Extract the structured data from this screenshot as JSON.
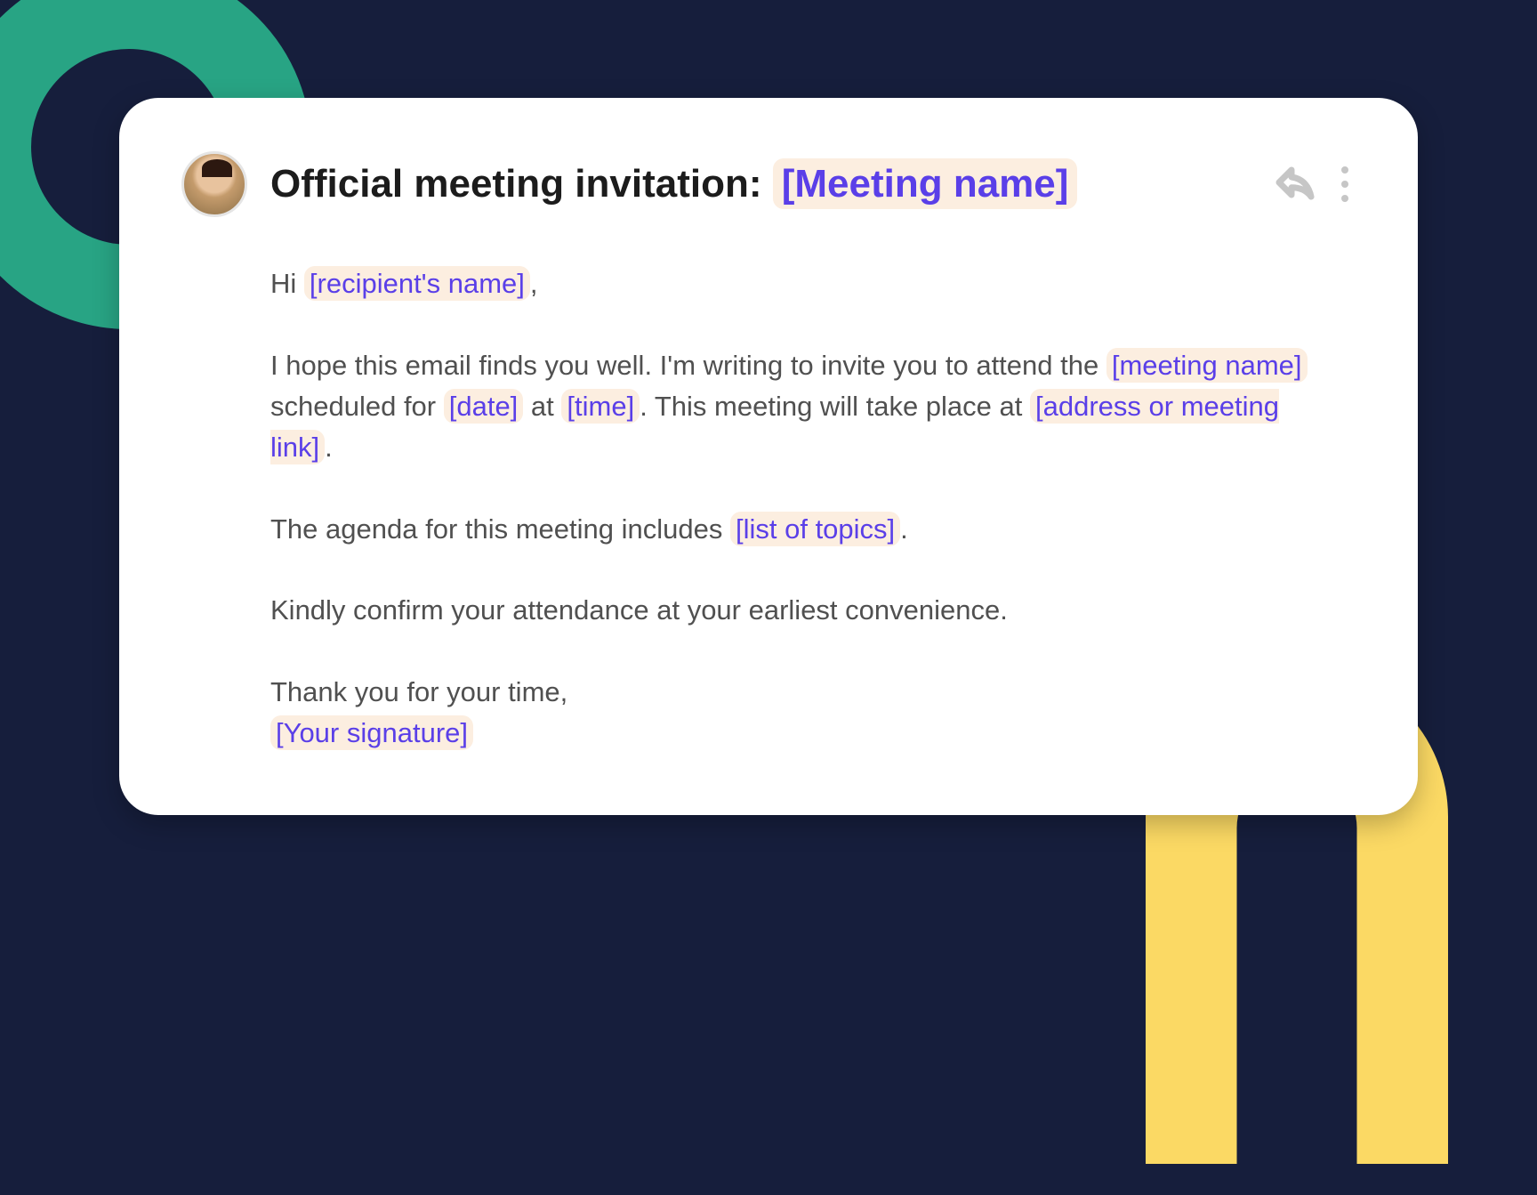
{
  "email": {
    "subject_prefix": "Official meeting invitation: ",
    "subject_placeholder": "[Meeting name]",
    "greeting_prefix": "Hi ",
    "greeting_placeholder": "[recipient's name]",
    "greeting_suffix": ",",
    "p1_a": "I hope this email finds you well. I'm writing to invite you to attend the ",
    "p1_meeting": "[meeting name]",
    "p1_b": " scheduled for ",
    "p1_date": "[date]",
    "p1_c": " at ",
    "p1_time": "[time]",
    "p1_d": ". This meeting will take place at ",
    "p1_location": "[address or meeting link]",
    "p1_e": ".",
    "p2_a": "The agenda for this meeting includes ",
    "p2_topics": "[list of topics]",
    "p2_b": ".",
    "p3": "Kindly confirm your attendance at your earliest convenience.",
    "p4_a": "Thank you for your time,",
    "p4_signature": "[Your signature]"
  },
  "icons": {
    "reply": "reply-icon",
    "more": "more-icon"
  }
}
